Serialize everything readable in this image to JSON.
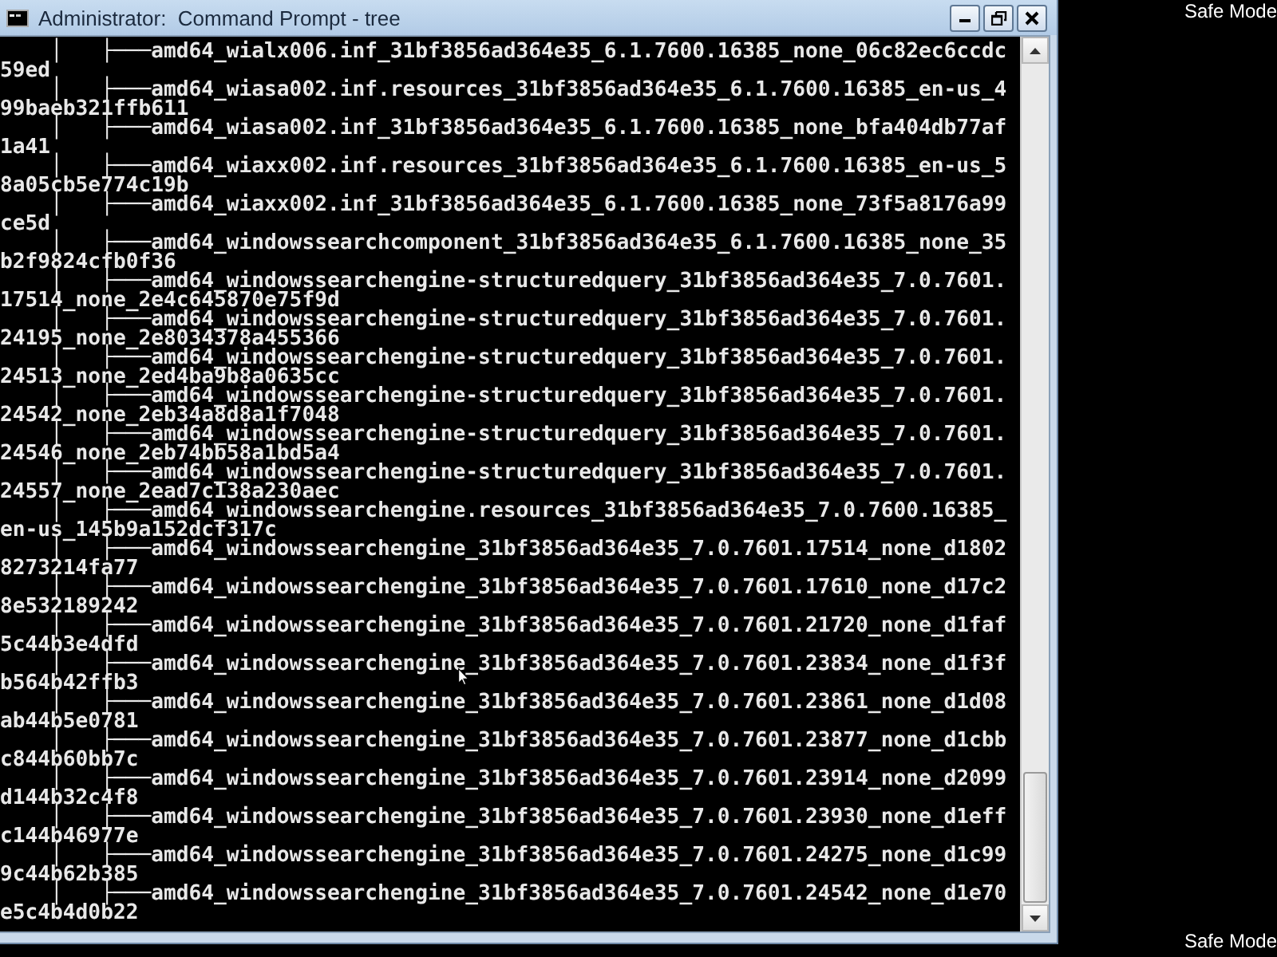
{
  "window": {
    "title": "Administrator:  Command Prompt - tree"
  },
  "console": {
    "lines": [
      "    │   ├───amd64_wialx006.inf_31bf3856ad364e35_6.1.7600.16385_none_06c82ec6ccdc",
      "59ed",
      "    │   ├───amd64_wiasa002.inf.resources_31bf3856ad364e35_6.1.7600.16385_en-us_4",
      "99baeb321ffb611",
      "    │   ├───amd64_wiasa002.inf_31bf3856ad364e35_6.1.7600.16385_none_bfa404db77af",
      "1a41",
      "    │   ├───amd64_wiaxx002.inf.resources_31bf3856ad364e35_6.1.7600.16385_en-us_5",
      "8a05cb5e774c19b",
      "    │   ├───amd64_wiaxx002.inf_31bf3856ad364e35_6.1.7600.16385_none_73f5a8176a99",
      "ce5d",
      "    │   ├───amd64_windowssearchcomponent_31bf3856ad364e35_6.1.7600.16385_none_35",
      "b2f9824cfb0f36",
      "    │   ├───amd64_windowssearchengine-structuredquery_31bf3856ad364e35_7.0.7601.",
      "17514_none_2e4c645870e75f9d",
      "    │   ├───amd64_windowssearchengine-structuredquery_31bf3856ad364e35_7.0.7601.",
      "24195_none_2e8034378a455366",
      "    │   ├───amd64_windowssearchengine-structuredquery_31bf3856ad364e35_7.0.7601.",
      "24513_none_2ed4ba9b8a0635cc",
      "    │   ├───amd64_windowssearchengine-structuredquery_31bf3856ad364e35_7.0.7601.",
      "24542_none_2eb34a8d8a1f7048",
      "    │   ├───amd64_windowssearchengine-structuredquery_31bf3856ad364e35_7.0.7601.",
      "24546_none_2eb74bb58a1bd5a4",
      "    │   ├───amd64_windowssearchengine-structuredquery_31bf3856ad364e35_7.0.7601.",
      "24557_none_2ead7c138a230aec",
      "    │   ├───amd64_windowssearchengine.resources_31bf3856ad364e35_7.0.7600.16385_",
      "en-us_145b9a152dcf317c",
      "    │   ├───amd64_windowssearchengine_31bf3856ad364e35_7.0.7601.17514_none_d1802",
      "8273214fa77",
      "    │   ├───amd64_windowssearchengine_31bf3856ad364e35_7.0.7601.17610_none_d17c2",
      "8e532189242",
      "    │   ├───amd64_windowssearchengine_31bf3856ad364e35_7.0.7601.21720_none_d1faf",
      "5c44b3e4dfd",
      "    │   ├───amd64_windowssearchengine_31bf3856ad364e35_7.0.7601.23834_none_d1f3f",
      "b564b42ffb3",
      "    │   ├───amd64_windowssearchengine_31bf3856ad364e35_7.0.7601.23861_none_d1d08",
      "ab44b5e0781",
      "    │   ├───amd64_windowssearchengine_31bf3856ad364e35_7.0.7601.23877_none_d1cbb",
      "c844b60bb7c",
      "    │   ├───amd64_windowssearchengine_31bf3856ad364e35_7.0.7601.23914_none_d2099",
      "d144b32c4f8",
      "    │   ├───amd64_windowssearchengine_31bf3856ad364e35_7.0.7601.23930_none_d1eff",
      "c144b46977e",
      "    │   ├───amd64_windowssearchengine_31bf3856ad364e35_7.0.7601.24275_none_d1c99",
      "9c44b62b385",
      "    │   ├───amd64_windowssearchengine_31bf3856ad364e35_7.0.7601.24542_none_d1e70",
      "e5c4b4d0b22"
    ]
  },
  "desktop": {
    "labels": [
      "Safe Mode",
      "Safe Mode"
    ]
  }
}
